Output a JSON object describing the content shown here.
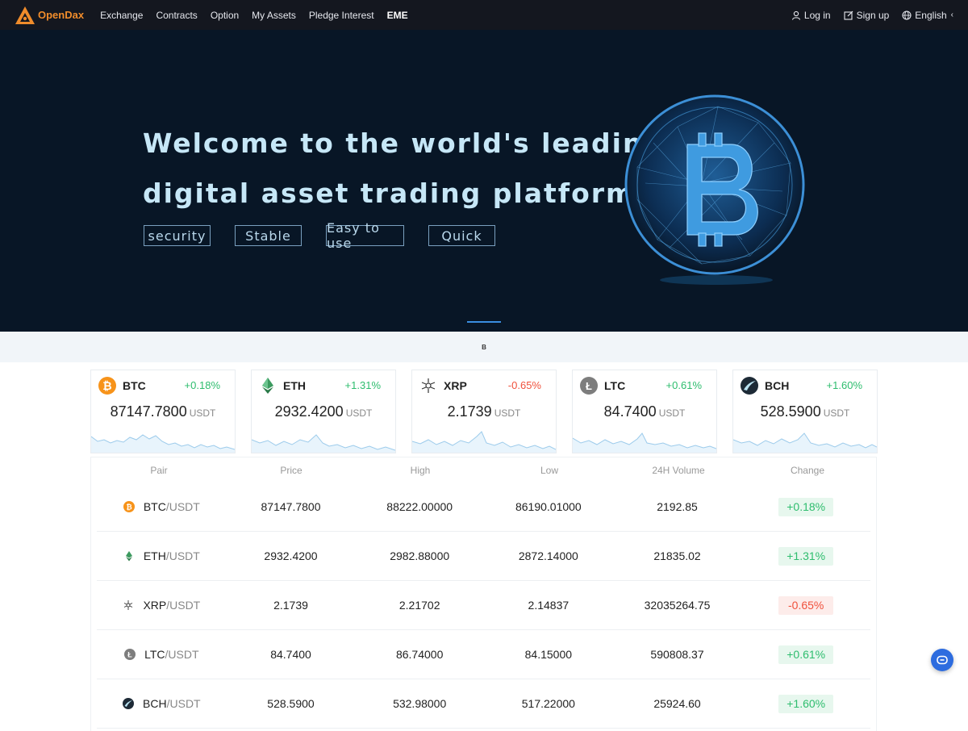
{
  "nav": {
    "logo": "OpenDax",
    "links": [
      "Exchange",
      "Contracts",
      "Option",
      "My Assets",
      "Pledge Interest",
      "EME"
    ],
    "login": "Log in",
    "signup": "Sign up",
    "language": "English"
  },
  "hero": {
    "line1": "Welcome to the world's leading",
    "line2": "digital asset trading platform",
    "tags": [
      "security",
      "Stable",
      "Easy to use",
      "Quick"
    ]
  },
  "strip": {
    "text": "B"
  },
  "cards": [
    {
      "symbol": "BTC",
      "change": "+0.18%",
      "price": "87147.7800",
      "unit": "USDT",
      "icon": "btc-icon",
      "trend": "up"
    },
    {
      "symbol": "ETH",
      "change": "+1.31%",
      "price": "2932.4200",
      "unit": "USDT",
      "icon": "eth-icon",
      "trend": "up"
    },
    {
      "symbol": "XRP",
      "change": "-0.65%",
      "price": "2.1739",
      "unit": "USDT",
      "icon": "xrp-icon",
      "trend": "down"
    },
    {
      "symbol": "LTC",
      "change": "+0.61%",
      "price": "84.7400",
      "unit": "USDT",
      "icon": "ltc-icon",
      "trend": "up"
    },
    {
      "symbol": "BCH",
      "change": "+1.60%",
      "price": "528.5900",
      "unit": "USDT",
      "icon": "bch-icon",
      "trend": "up"
    }
  ],
  "table": {
    "headers": [
      "Pair",
      "Price",
      "High",
      "Low",
      "24H Volume",
      "Change"
    ],
    "rows": [
      {
        "base": "BTC",
        "quote": "/USDT",
        "price": "87147.7800",
        "high": "88222.00000",
        "low": "86190.01000",
        "volume": "2192.85",
        "change": "+0.18%",
        "trend": "up"
      },
      {
        "base": "ETH",
        "quote": "/USDT",
        "price": "2932.4200",
        "high": "2982.88000",
        "low": "2872.14000",
        "volume": "21835.02",
        "change": "+1.31%",
        "trend": "up"
      },
      {
        "base": "XRP",
        "quote": "/USDT",
        "price": "2.1739",
        "high": "2.21702",
        "low": "2.14837",
        "volume": "32035264.75",
        "change": "-0.65%",
        "trend": "down"
      },
      {
        "base": "LTC",
        "quote": "/USDT",
        "price": "84.7400",
        "high": "86.74000",
        "low": "84.15000",
        "volume": "590808.37",
        "change": "+0.61%",
        "trend": "up"
      },
      {
        "base": "BCH",
        "quote": "/USDT",
        "price": "528.5900",
        "high": "532.98000",
        "low": "517.22000",
        "volume": "25924.60",
        "change": "+1.60%",
        "trend": "up"
      }
    ]
  },
  "colors": {
    "up": "#2ebd6e",
    "down": "#f0513c",
    "brand": "#f08c2b",
    "accent": "#3a8ee0"
  }
}
